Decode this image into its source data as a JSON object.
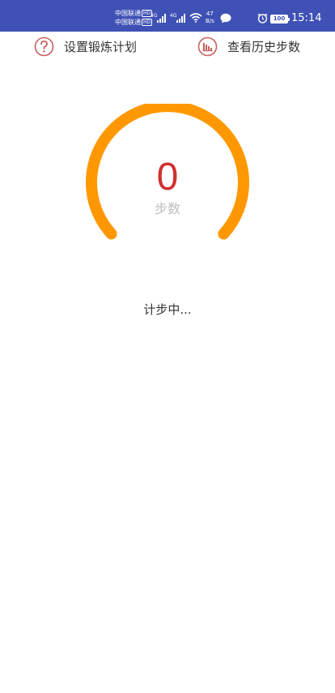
{
  "status_bar": {
    "carrier_1": "中国联通",
    "carrier_2": "中国联通",
    "hd_badge": "HD",
    "net_speed_value": "47",
    "net_speed_unit": "B/s",
    "battery": "100",
    "time": "15:14",
    "icons": [
      "signal-icon",
      "signal-icon",
      "wifi-icon",
      "chat-icon",
      "alarm-icon",
      "battery-icon"
    ]
  },
  "toolbar": {
    "set_plan_label": "设置锻炼计划",
    "history_label": "查看历史步数",
    "set_plan_icon": "question-circle-icon",
    "history_icon": "bar-chart-icon"
  },
  "gauge": {
    "steps": "0",
    "unit_label": "步数",
    "progress": 0,
    "arc_color": "#FF9800",
    "count_color": "#D32F2F"
  },
  "status_text": "计步中..."
}
